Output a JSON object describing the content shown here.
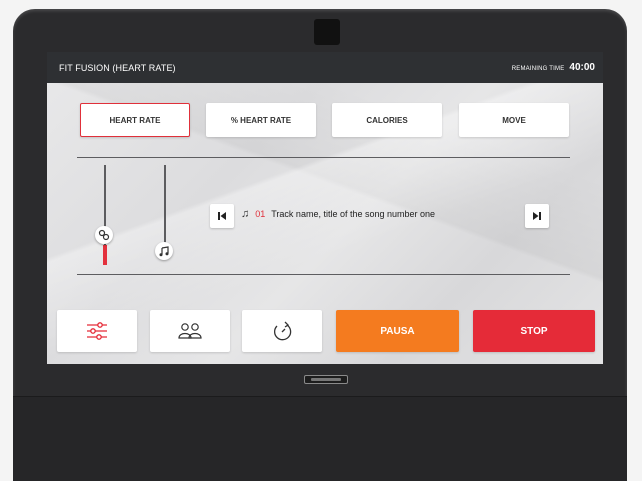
{
  "header": {
    "title": "FIT FUSION (HEART RATE)",
    "remaining_label": "REMAINING TIME",
    "remaining_value": "40:00"
  },
  "tabs": [
    {
      "label": "HEART RATE",
      "active": true
    },
    {
      "label": "% HEART RATE",
      "active": false
    },
    {
      "label": "CALORIES",
      "active": false
    },
    {
      "label": "MOVE",
      "active": false
    }
  ],
  "sliders": {
    "speed": {
      "icon": "speed-icon",
      "level": 0.15
    },
    "volume": {
      "icon": "music-note-icon",
      "level": 0.0
    }
  },
  "track": {
    "number": "01",
    "name": "Track name, title of the song number one"
  },
  "bottom": {
    "pause_label": "PAUSA",
    "stop_label": "STOP"
  },
  "colors": {
    "accent_red": "#e52b38",
    "accent_orange": "#f47b1f",
    "topbar": "#2e3033"
  }
}
